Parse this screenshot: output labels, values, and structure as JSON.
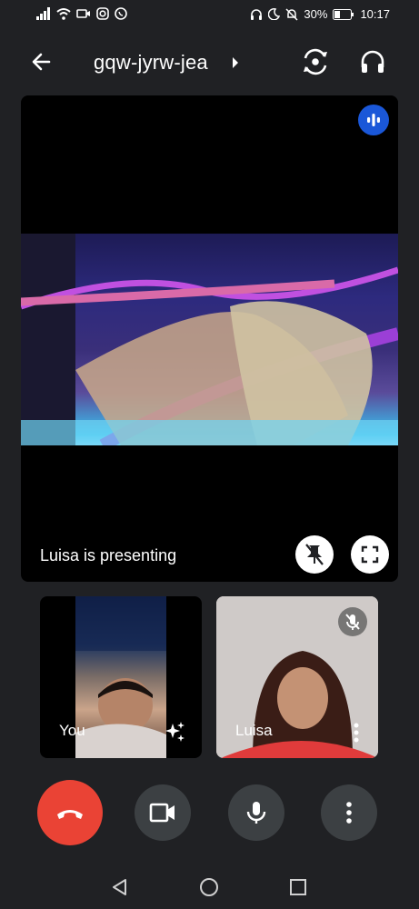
{
  "status": {
    "battery": "30%",
    "time": "10:17"
  },
  "header": {
    "title": "gqw-jyrw-jea"
  },
  "stage": {
    "presenting_text": "Luisa is presenting"
  },
  "tiles": [
    {
      "name": "You"
    },
    {
      "name": "Luisa"
    }
  ],
  "colors": {
    "end_call": "#ea4335",
    "speaking_indicator": "#1a57d8",
    "background": "#202124"
  },
  "icons": {
    "back": "arrow-left-icon",
    "flip_camera": "switch-camera-icon",
    "audio": "headset-icon",
    "speaking": "audio-level-icon",
    "pin": "unpin-icon",
    "fullscreen": "fullscreen-icon",
    "effects": "sparkle-effects-icon",
    "mic_off": "mic-off-icon",
    "more": "more-vertical-icon",
    "end_call": "phone-hangup-icon",
    "camera": "videocam-icon",
    "mic": "mic-icon"
  }
}
